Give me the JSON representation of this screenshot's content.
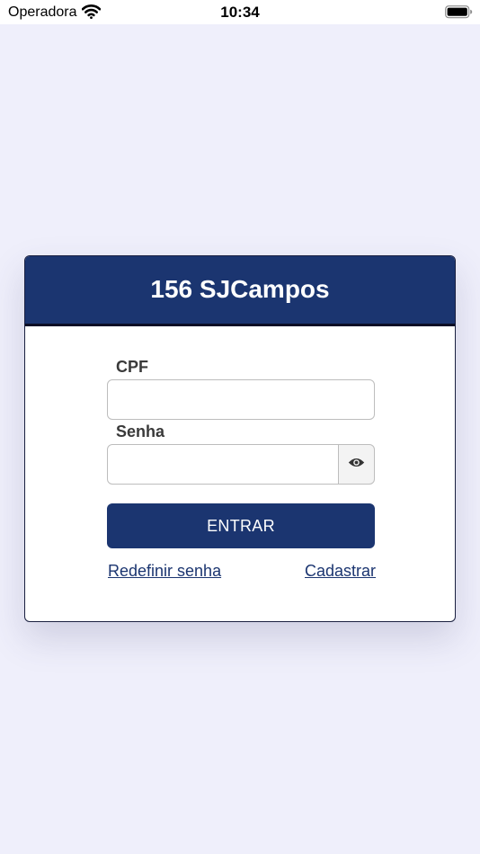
{
  "status_bar": {
    "carrier": "Operadora",
    "time": "10:34"
  },
  "login": {
    "title": "156 SJCampos",
    "cpf_label": "CPF",
    "cpf_value": "",
    "senha_label": "Senha",
    "senha_value": "",
    "submit_label": "ENTRAR",
    "reset_link": "Redefinir senha",
    "signup_link": "Cadastrar"
  },
  "colors": {
    "brand": "#1b3570",
    "background": "#efeffb"
  },
  "icons": {
    "wifi": "wifi-icon",
    "battery": "battery-icon",
    "toggle": "eye-icon"
  }
}
